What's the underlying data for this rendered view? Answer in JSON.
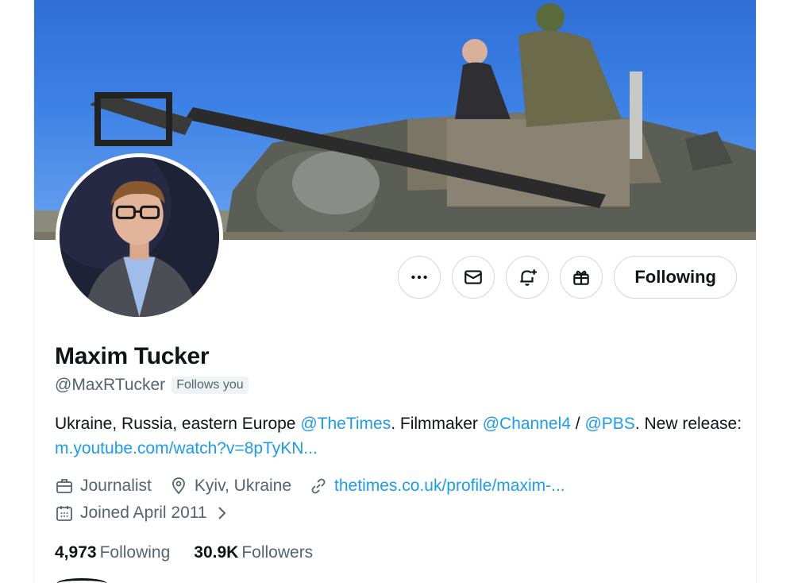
{
  "profile": {
    "name": "Maxim Tucker",
    "handle": "@MaxRTucker",
    "follows_you_badge": "Follows you",
    "bio": {
      "text1": "Ukraine, Russia, eastern Europe ",
      "mention1": "@TheTimes",
      "text2": ". Filmmaker ",
      "mention2": "@Channel4",
      "text3": " / ",
      "mention3": "@PBS",
      "text4": ". New release: ",
      "link": "m.youtube.com/watch?v=8pTyKN..."
    },
    "meta": {
      "profession": "Journalist",
      "location": "Kyiv, Ukraine",
      "website": "thetimes.co.uk/profile/maxim-...",
      "joined": "Joined April 2011"
    },
    "stats": {
      "following_count": "4,973",
      "following_label": "Following",
      "followers_count": "30.9K",
      "followers_label": "Followers"
    }
  },
  "actions": {
    "follow_label": "Following"
  },
  "icons": {
    "more": "more-icon",
    "message": "envelope-icon",
    "notify": "bell-plus-icon",
    "gift": "gift-icon",
    "profession": "briefcase-icon",
    "location": "location-pin-icon",
    "website": "link-icon",
    "joined": "calendar-icon"
  },
  "colors": {
    "accent": "#1d9bf0",
    "text_primary": "#0f1419",
    "text_secondary": "#536471",
    "border": "#cfd9de"
  }
}
